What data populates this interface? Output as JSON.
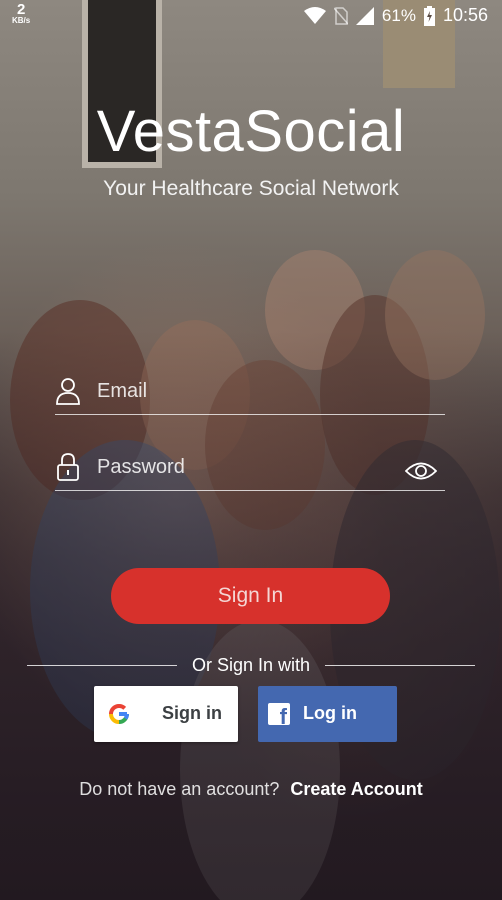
{
  "status_bar": {
    "speed_value": "2",
    "speed_unit": "KB/s",
    "battery": "61%",
    "time": "10:56",
    "icons": [
      "wifi-icon",
      "no-sim-icon",
      "signal-icon",
      "battery-charging-icon"
    ]
  },
  "app": {
    "title": "VestaSocial",
    "subtitle": "Your Healthcare Social Network"
  },
  "form": {
    "email_placeholder": "Email",
    "password_placeholder": "Password",
    "sign_in_label": "Sign In"
  },
  "social": {
    "divider_text": "Or Sign In with",
    "google_label": "Sign in",
    "facebook_label": "Log in"
  },
  "account": {
    "prompt": "Do not have an account?",
    "create_label": "Create Account"
  },
  "colors": {
    "sign_in_button": "#d7312c",
    "facebook_button": "#4468b0",
    "google_button": "#ffffff"
  }
}
